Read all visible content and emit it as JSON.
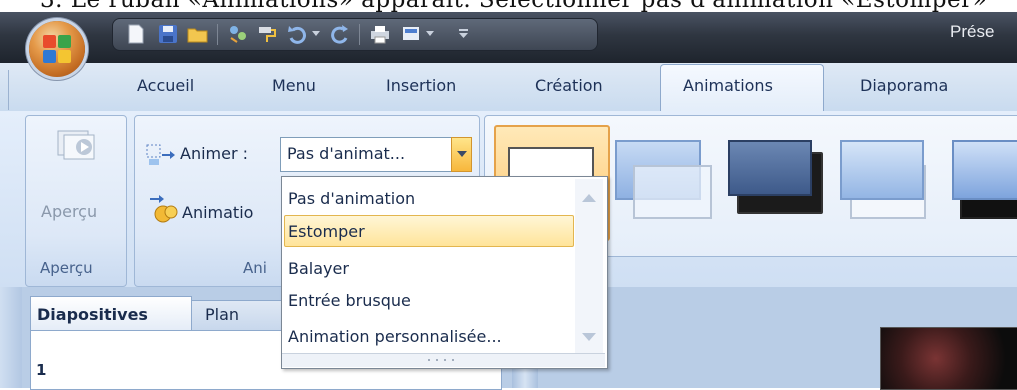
{
  "instruction": {
    "text": "3.   Le ruban «Animations» apparaît. Sélectionner pas d'animation «Estomper»"
  },
  "window": {
    "title": "Prése"
  },
  "tabs": [
    {
      "label": "Accueil"
    },
    {
      "label": "Menu"
    },
    {
      "label": "Insertion"
    },
    {
      "label": "Création"
    },
    {
      "label": "Animations",
      "active": true
    },
    {
      "label": "Diaporama"
    }
  ],
  "ribbon": {
    "preview_group": {
      "button_label": "Aperçu",
      "group_label": "Aperçu"
    },
    "animations_group": {
      "animate_label": "Animer :",
      "animate_value": "Pas d'animat...",
      "custom_label": "Animatio",
      "group_label": "Ani"
    }
  },
  "dropdown": {
    "items": [
      {
        "label": "Pas d'animation"
      },
      {
        "label": "Estomper",
        "highlighted": true
      },
      {
        "label": "Balayer"
      },
      {
        "label": "Entrée brusque"
      },
      {
        "label": "Animation personnalisée..."
      }
    ]
  },
  "side_panel": {
    "tabs": [
      {
        "label": "Diapositives",
        "active": true
      },
      {
        "label": "Plan"
      }
    ],
    "slide_number": "1"
  },
  "colors": {
    "accent_highlight": "#ffe49a",
    "ribbon_text": "#1d3157",
    "titlebar": "#2f3641"
  }
}
